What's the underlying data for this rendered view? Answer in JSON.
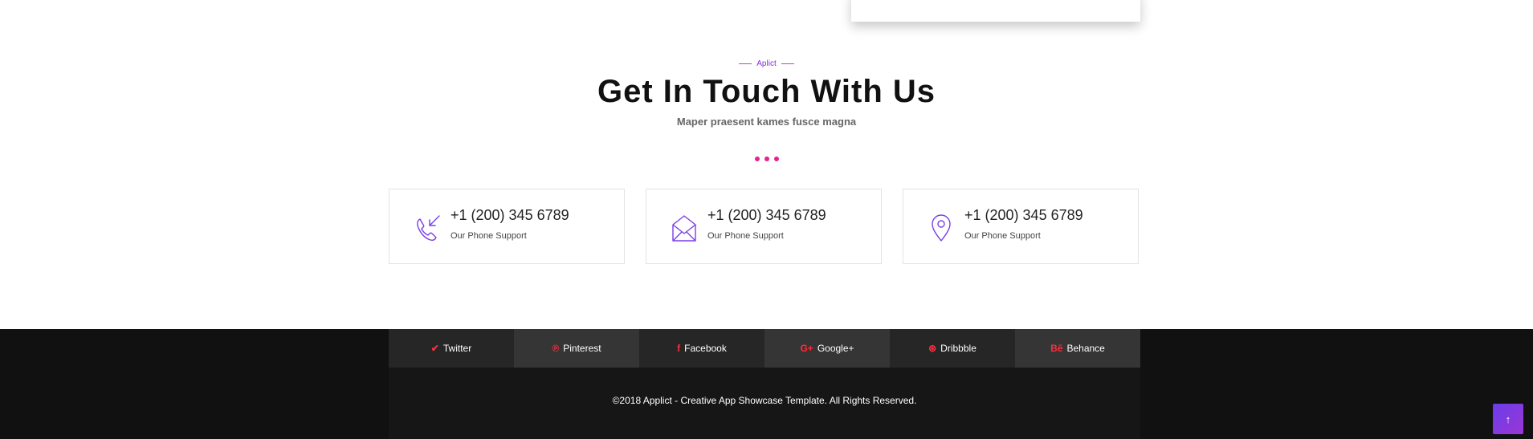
{
  "header": {
    "eyebrow": "Aplict",
    "title": "Get In Touch With Us",
    "subtitle": "Maper praesent kames fusce magna"
  },
  "contacts": [
    {
      "icon": "phone-icon",
      "value": "+1 (200) 345 6789",
      "label": "Our Phone Support"
    },
    {
      "icon": "envelope-icon",
      "value": "+1 (200) 345 6789",
      "label": "Our Phone Support"
    },
    {
      "icon": "map-pin-icon",
      "value": "+1 (200) 345 6789",
      "label": "Our Phone Support"
    }
  ],
  "social": [
    {
      "icon": "twitter-icon",
      "glyph": "✔",
      "label": "Twitter"
    },
    {
      "icon": "pinterest-icon",
      "glyph": "℗",
      "label": "Pinterest"
    },
    {
      "icon": "facebook-icon",
      "glyph": "f",
      "label": "Facebook"
    },
    {
      "icon": "google-plus-icon",
      "glyph": "G+",
      "label": "Google+"
    },
    {
      "icon": "dribbble-icon",
      "glyph": "⊛",
      "label": "Dribbble"
    },
    {
      "icon": "behance-icon",
      "glyph": "Bē",
      "label": "Behance"
    }
  ],
  "footer": {
    "copyright": "©2018 Applict - Creative App Showcase Template. All Rights Reserved."
  },
  "back_to_top": {
    "icon": "arrow-up-icon",
    "glyph": "↑"
  },
  "colors": {
    "accent_purple": "#7b3fe4",
    "accent_pink": "#e6238f",
    "social_icon_red": "#ff2c3b",
    "footer_bg": "#111111"
  }
}
